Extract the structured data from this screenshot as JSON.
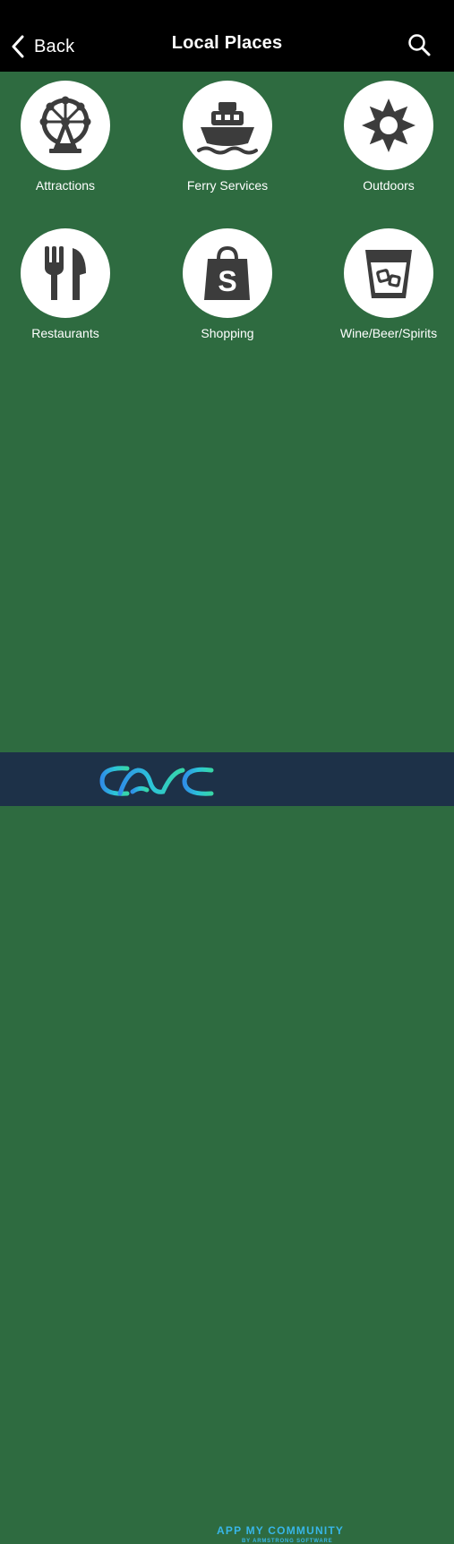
{
  "nav": {
    "back_label": "Back",
    "title": "Local Places",
    "back_icon": "chevron-left-icon",
    "search_icon": "search-icon"
  },
  "categories": [
    {
      "label": "Attractions",
      "icon": "ferris-wheel-icon"
    },
    {
      "label": "Ferry Services",
      "icon": "ferry-icon"
    },
    {
      "label": "Outdoors",
      "icon": "sun-icon"
    },
    {
      "label": "Restaurants",
      "icon": "fork-knife-icon"
    },
    {
      "label": "Shopping",
      "icon": "shopping-bag-icon"
    },
    {
      "label": "Wine/Beer/Spirits",
      "icon": "glass-with-ice-icon"
    }
  ],
  "footer": {
    "brand_name": "APP MY COMMUNITY",
    "brand_sub": "BY ARMSTRONG SOFTWARE",
    "logo_icon": "amc-logo-icon"
  },
  "colors": {
    "background": "#2e6b40",
    "nav_bar": "#000000",
    "footer": "#1d3148",
    "icon_circle": "#ffffff",
    "icon_glyph": "#3c3c3c",
    "brand_accent": "#38b6e8"
  }
}
